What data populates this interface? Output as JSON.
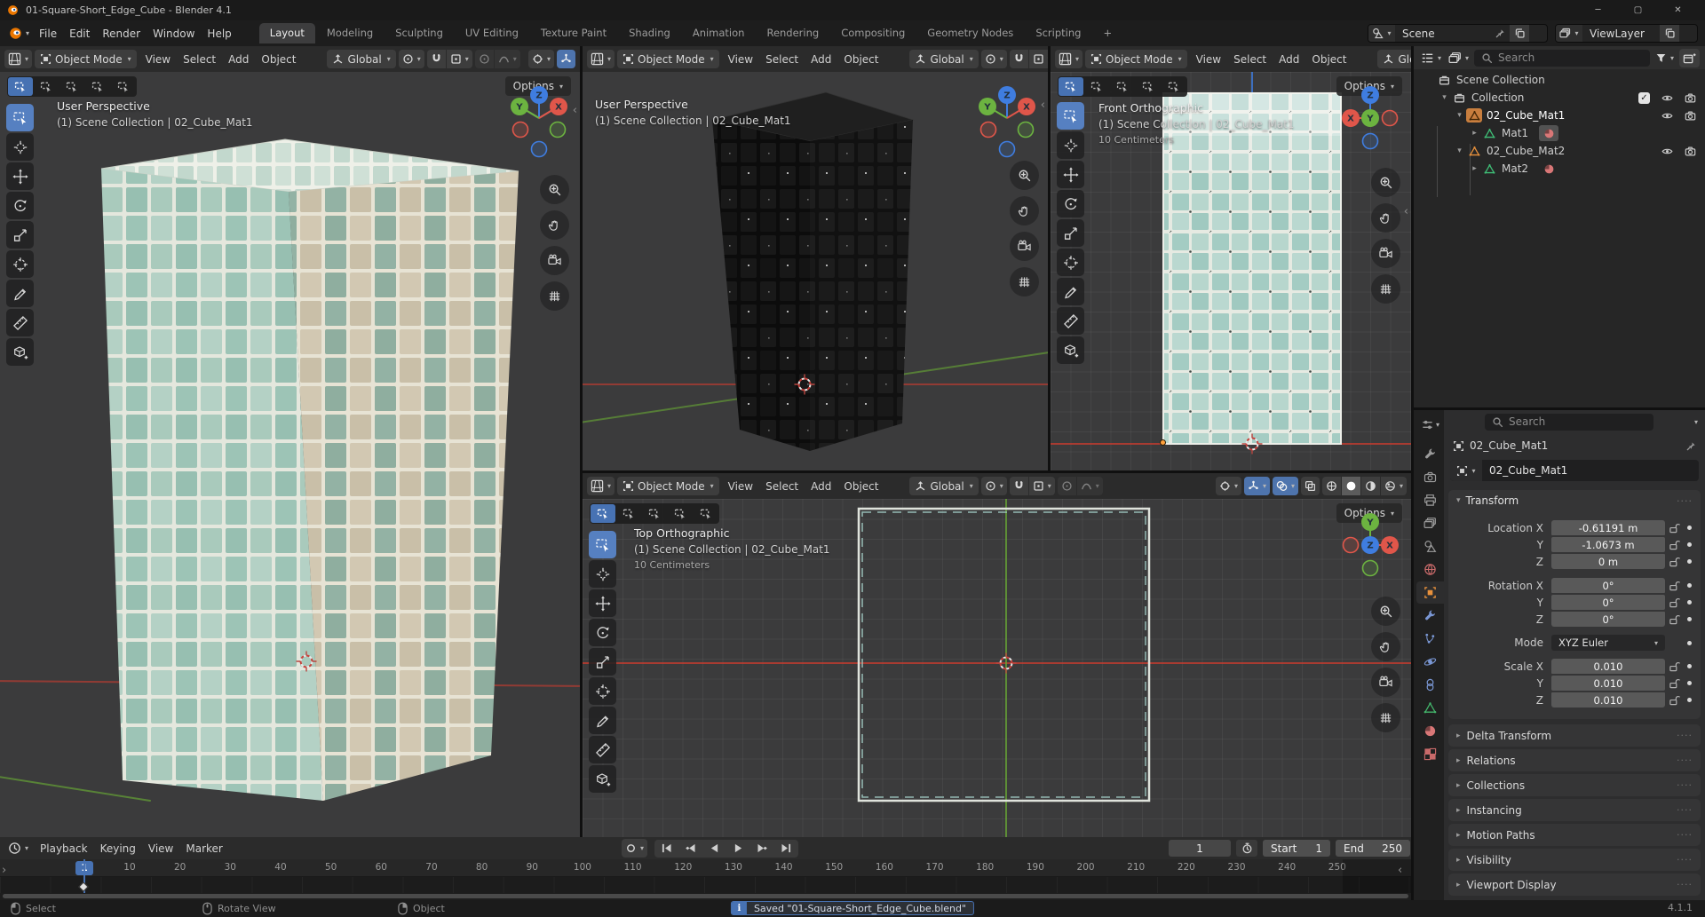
{
  "window": {
    "title": "01-Square-Short_Edge_Cube - Blender 4.1",
    "controls": {
      "minimize": "─",
      "maximize": "▢",
      "close": "✕"
    }
  },
  "glyphs": {
    "dropdown": "▾",
    "expand": "▸",
    "collapse": "▾",
    "chev_left": "‹",
    "chev_right": "›",
    "grip": "····",
    "info": "i",
    "check": "✓"
  },
  "colors": {
    "accent_blue": "#4772b3",
    "object_orange": "#e8913c",
    "axis_x": "#e0564a",
    "axis_y": "#6cb340",
    "axis_z": "#3f7de0",
    "mesh_green": "#3fbf77",
    "material_pink": "#d97777",
    "texture_teal": "#a2cbc2"
  },
  "topbar": {
    "menus": [
      "File",
      "Edit",
      "Render",
      "Window",
      "Help"
    ],
    "tabs": [
      {
        "label": "Layout",
        "active": true
      },
      {
        "label": "Modeling"
      },
      {
        "label": "Sculpting"
      },
      {
        "label": "UV Editing"
      },
      {
        "label": "Texture Paint"
      },
      {
        "label": "Shading"
      },
      {
        "label": "Animation"
      },
      {
        "label": "Rendering"
      },
      {
        "label": "Compositing"
      },
      {
        "label": "Geometry Nodes"
      },
      {
        "label": "Scripting"
      },
      {
        "label": "+"
      }
    ],
    "scene": "Scene",
    "viewlayer": "ViewLayer"
  },
  "vp_header": {
    "mode": "Object Mode",
    "menus": [
      "View",
      "Select",
      "Add",
      "Object"
    ],
    "orientation": "Global",
    "options": "Options"
  },
  "viewports": {
    "persp_large": {
      "view": "User Perspective",
      "context": "(1) Scene Collection | 02_Cube_Mat1"
    },
    "persp_small": {
      "view": "User Perspective",
      "context": "(1) Scene Collection | 02_Cube_Mat1"
    },
    "front": {
      "view": "Front Orthographic",
      "context": "(1) Scene Collection | 02_Cube_Mat1",
      "scale": "10 Centimeters"
    },
    "top": {
      "view": "Top Orthographic",
      "context": "(1) Scene Collection | 02_Cube_Mat1",
      "scale": "10 Centimeters"
    }
  },
  "gizmo": {
    "x": "X",
    "y": "Y",
    "z": "Z"
  },
  "tools": [
    "select-box",
    "cursor",
    "move",
    "rotate",
    "scale",
    "transform",
    "annotate",
    "measure",
    "add-cube"
  ],
  "nav": [
    "zoom",
    "pan",
    "camera",
    "grid"
  ],
  "outliner": {
    "search_placeholder": "Search",
    "items": [
      {
        "label": "Scene Collection",
        "indent": 0,
        "icon": "collection"
      },
      {
        "label": "Collection",
        "indent": 1,
        "icon": "collection",
        "expander": "collapse",
        "right": [
          "check",
          "eye",
          "camera"
        ]
      },
      {
        "label": "02_Cube_Mat1",
        "indent": 2,
        "icon": "mesh",
        "active": true,
        "expander": "collapse",
        "right": [
          "eye",
          "camera"
        ]
      },
      {
        "label": "Mat1",
        "indent": 3,
        "icon": "meshdata",
        "expander": "expand",
        "mat": true,
        "mat_active": true
      },
      {
        "label": "02_Cube_Mat2",
        "indent": 2,
        "icon": "mesh",
        "expander": "collapse",
        "right": [
          "eye",
          "camera"
        ]
      },
      {
        "label": "Mat2",
        "indent": 3,
        "icon": "meshdata",
        "expander": "expand",
        "mat": true
      }
    ]
  },
  "properties": {
    "search_placeholder": "Search",
    "breadcrumb": "02_Cube_Mat1",
    "object_name": "02_Cube_Mat1",
    "tabs": [
      {
        "icon": "tool"
      },
      {
        "icon": "render"
      },
      {
        "icon": "output"
      },
      {
        "icon": "viewlayer"
      },
      {
        "icon": "scene"
      },
      {
        "icon": "world"
      },
      {
        "icon": "object",
        "active": true
      },
      {
        "icon": "modifier"
      },
      {
        "icon": "particles"
      },
      {
        "icon": "physics"
      },
      {
        "icon": "constraint"
      },
      {
        "icon": "data"
      },
      {
        "icon": "material"
      },
      {
        "icon": "texture"
      }
    ],
    "transform": {
      "title": "Transform",
      "location": [
        {
          "label": "Location X",
          "value": "-0.61191 m"
        },
        {
          "label": "Y",
          "value": "-1.0673 m"
        },
        {
          "label": "Z",
          "value": "0 m"
        }
      ],
      "rotation": [
        {
          "label": "Rotation X",
          "value": "0°"
        },
        {
          "label": "Y",
          "value": "0°"
        },
        {
          "label": "Z",
          "value": "0°"
        }
      ],
      "mode_label": "Mode",
      "mode_value": "XYZ Euler",
      "scale": [
        {
          "label": "Scale X",
          "value": "0.010"
        },
        {
          "label": "Y",
          "value": "0.010"
        },
        {
          "label": "Z",
          "value": "0.010"
        }
      ]
    },
    "panels": [
      "Delta Transform",
      "Relations",
      "Collections",
      "Instancing",
      "Motion Paths",
      "Visibility",
      "Viewport Display"
    ]
  },
  "timeline": {
    "menus": [
      "Playback",
      "Keying",
      "View",
      "Marker"
    ],
    "playback": [
      "jump-start",
      "prev-key",
      "play-back",
      "play",
      "next-key",
      "jump-end"
    ],
    "current_frame": "1",
    "frame_value": "1",
    "start_label": "Start",
    "start_value": "1",
    "end_label": "End",
    "end_value": "250",
    "tick_start": 10,
    "tick_end": 250,
    "tick_step": 10
  },
  "statusbar": {
    "hints": [
      {
        "icon": "left",
        "label": "Select"
      },
      {
        "icon": "middle",
        "label": "Rotate View"
      },
      {
        "icon": "right",
        "label": "Object"
      }
    ],
    "message": "Saved \"01-Square-Short_Edge_Cube.blend\"",
    "version": "4.1.1"
  }
}
